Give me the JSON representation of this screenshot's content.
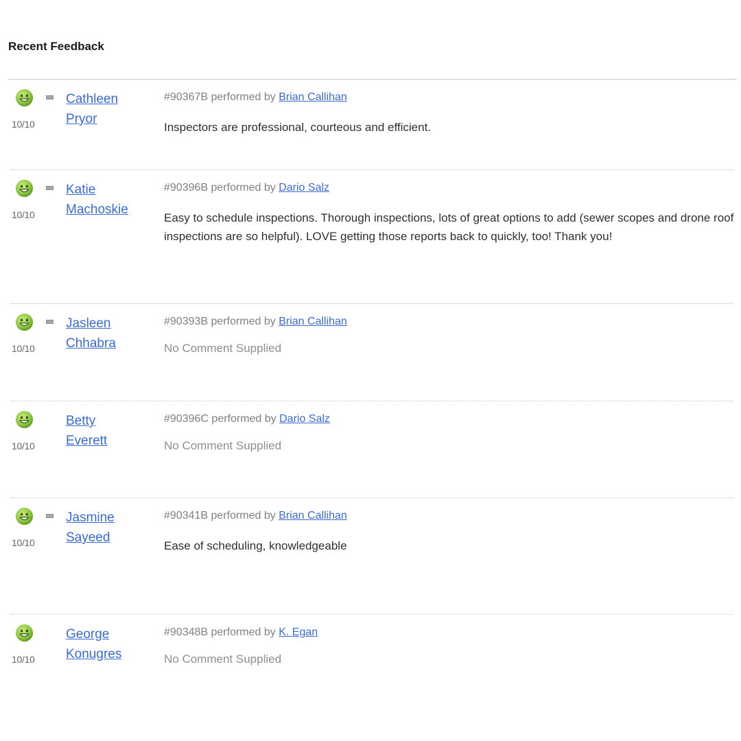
{
  "page": {
    "title": "Recent Feedback"
  },
  "feedback": [
    {
      "score": "10/10",
      "customer_first": "Cathleen",
      "customer_last": "Pryor",
      "has_flag": true,
      "job": "#90367B performed by ",
      "inspector": "Brian Callihan",
      "comment": "Inspectors are professional, courteous and efficient.",
      "has_comment": true
    },
    {
      "score": "10/10",
      "customer_first": "Katie",
      "customer_last": "Machoskie",
      "has_flag": true,
      "job": "#90396B performed by ",
      "inspector": "Dario Salz",
      "comment": "Easy to schedule inspections. Thorough inspections, lots of great options to add (sewer scopes and drone roof inspections are so helpful). LOVE getting those reports back to quickly, too! Thank you!",
      "has_comment": true
    },
    {
      "score": "10/10",
      "customer_first": "Jasleen",
      "customer_last": "Chhabra",
      "has_flag": true,
      "job": "#90393B performed by ",
      "inspector": "Brian Callihan",
      "comment": "No Comment Supplied",
      "has_comment": false
    },
    {
      "score": "10/10",
      "customer_first": "Betty",
      "customer_last": "Everett",
      "has_flag": false,
      "job": "#90396C performed by ",
      "inspector": "Dario Salz",
      "comment": "No Comment Supplied",
      "has_comment": false
    },
    {
      "score": "10/10",
      "customer_first": "Jasmine",
      "customer_last": "Sayeed",
      "has_flag": true,
      "job": "#90341B performed by ",
      "inspector": "Brian Callihan",
      "comment": "Ease of scheduling, knowledgeable",
      "has_comment": true
    },
    {
      "score": "10/10",
      "customer_first": "George",
      "customer_last": "Konugres",
      "has_flag": false,
      "job": "#90348B performed by ",
      "inspector": "K. Egan",
      "comment": "No Comment Supplied",
      "has_comment": false
    }
  ],
  "icons": {
    "rating": "happy-face-icon",
    "flag": "note-flag-icon"
  },
  "colors": {
    "link": "#3a6bd4",
    "smiley_face": "#8cc63f",
    "muted_text": "#808080"
  }
}
